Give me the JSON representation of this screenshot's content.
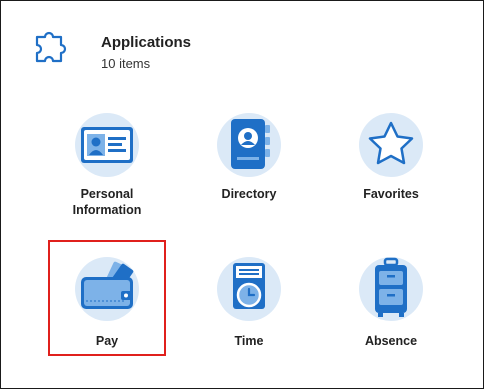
{
  "header": {
    "icon": "puzzle-piece-icon",
    "title": "Applications",
    "count": "10 items"
  },
  "apps": [
    {
      "label": "Personal Information",
      "icon": "id-card-icon"
    },
    {
      "label": "Directory",
      "icon": "address-book-icon"
    },
    {
      "label": "Favorites",
      "icon": "star-icon"
    },
    {
      "label": "Pay",
      "icon": "wallet-icon",
      "selected": true
    },
    {
      "label": "Time",
      "icon": "timesheet-clock-icon"
    },
    {
      "label": "Absence",
      "icon": "suitcase-icon"
    }
  ],
  "colors": {
    "icon_bg": "#dbe9f7",
    "icon_blue": "#1f6fc6",
    "icon_light": "#7db2e8",
    "selection": "#e0201c"
  }
}
